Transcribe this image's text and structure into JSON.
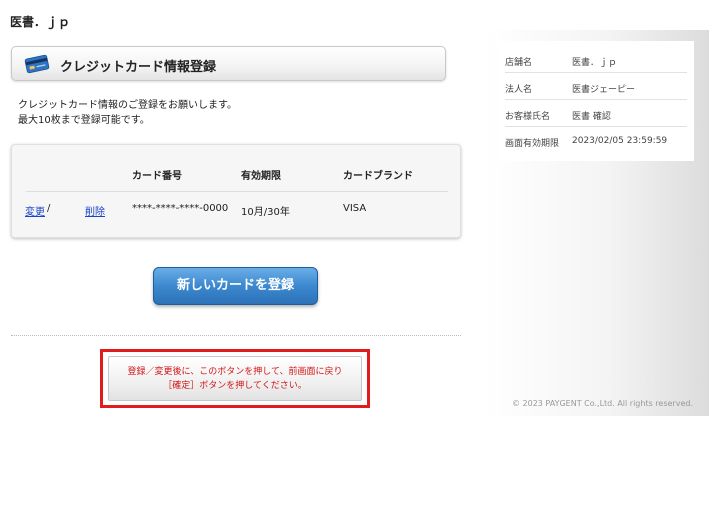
{
  "site": {
    "title": "医書．ｊｐ"
  },
  "banner": {
    "title": "クレジットカード情報登録",
    "icon": "credit-card-icon"
  },
  "intro": {
    "line1": "クレジットカード情報のご登録をお願いします。",
    "line2": "最大10枚まで登録可能です。"
  },
  "card_table": {
    "headers": {
      "number": "カード番号",
      "expiry": "有効期限",
      "brand": "カードブランド"
    },
    "rows": [
      {
        "change_label": "変更",
        "separator": "/",
        "delete_label": "削除",
        "number": "****-****-****-0000",
        "expiry": "10月/30年",
        "brand": "VISA"
      }
    ]
  },
  "register_button": {
    "label": "新しいカードを登録"
  },
  "note_button": {
    "line1": "登録／変更後に、このボタンを押して、前画面に戻り",
    "line2": "［確定］ボタンを押してください。"
  },
  "info": {
    "rows": [
      {
        "label": "店舗名",
        "value": "医書．ｊｐ"
      },
      {
        "label": "法人名",
        "value": "医書ジェーピー"
      },
      {
        "label": "お客様氏名",
        "value": "医書 確認"
      },
      {
        "label": "画面有効期限",
        "value": "2023/02/05 23:59:59"
      }
    ]
  },
  "footer": {
    "copyright": "© 2023 PAYGENT Co.,Ltd. All rights reserved."
  },
  "colors": {
    "accent_blue": "#3c88cf",
    "highlight_red": "#e21b1b",
    "link": "#1a44c8"
  }
}
